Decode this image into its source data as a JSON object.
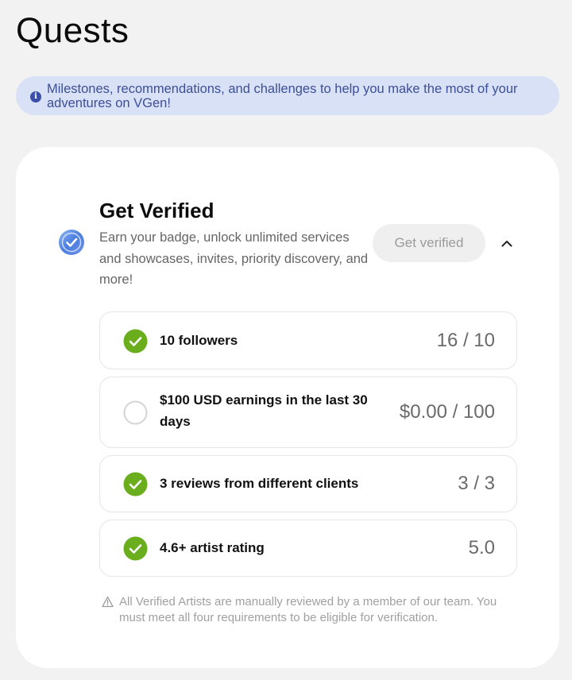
{
  "page": {
    "title": "Quests"
  },
  "banner": {
    "icon": "info-icon",
    "text": "Milestones, recommendations, and challenges to help you make the most of your adventures on VGen!"
  },
  "quest": {
    "title": "Get Verified",
    "description": "Earn your badge, unlock unlimited services and showcases, invites, priority discovery, and more!",
    "button_label": "Get verified",
    "badge_icon": "verified-badge-icon",
    "toggle_icon": "chevron-up-icon",
    "requirements": [
      {
        "label": "10 followers",
        "value": "16 / 10",
        "completed": true
      },
      {
        "label": "$100 USD earnings in the last 30 days",
        "value": "$0.00 / 100",
        "completed": false
      },
      {
        "label": "3 reviews from different clients",
        "value": "3 / 3",
        "completed": true
      },
      {
        "label": "4.6+ artist rating",
        "value": "5.0",
        "completed": true
      }
    ],
    "disclaimer": "All Verified Artists are manually reviewed by a member of our team. You must meet all four requirements to be eligible for verification."
  },
  "colors": {
    "page_background": "#f2f2f3",
    "banner_background": "#d9e1f7",
    "banner_text": "#3d4f95",
    "check_green": "#6aae1e",
    "badge_blue": "#4a7ee0"
  }
}
